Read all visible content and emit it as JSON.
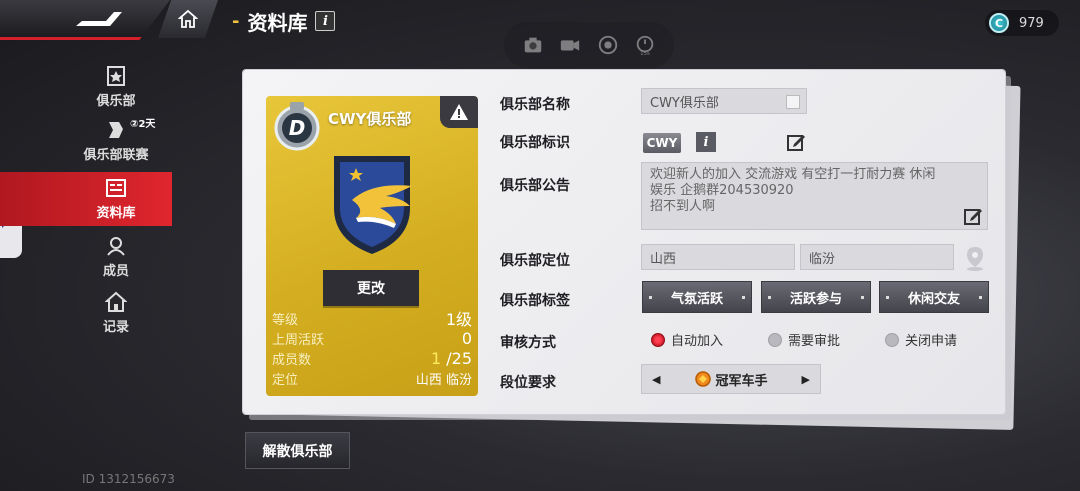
{
  "header": {
    "title": "资料库",
    "info_label": "i",
    "coins": "979",
    "coin_symbol": "C",
    "timer_label": "15s"
  },
  "sidebar": {
    "items": [
      {
        "label": "俱乐部",
        "icon": "club-icon"
      },
      {
        "label": "俱乐部联赛",
        "icon": "league-icon"
      },
      {
        "label": "资料库",
        "icon": "database-icon"
      },
      {
        "label": "成员",
        "icon": "members-icon"
      },
      {
        "label": "记录",
        "icon": "records-icon"
      }
    ],
    "league_timer": "②2天",
    "active_index": 2
  },
  "card": {
    "club_name": "CWY俱乐部",
    "rank_letter": "D",
    "change_label": "更改",
    "stats": {
      "level_label": "等级",
      "level_value": "1级",
      "activity_label": "上周活跃",
      "activity_value": "0",
      "members_label": "成员数",
      "members_current": "1",
      "members_max": "/25",
      "location_label": "定位",
      "location_value": "山西 临汾"
    }
  },
  "form": {
    "name_label": "俱乐部名称",
    "name_value": "CWY俱乐部",
    "tag_label": "俱乐部标识",
    "tag_value": "CWY",
    "tag_info": "i",
    "notice_label": "俱乐部公告",
    "notice_lines": [
      "欢迎新人的加入  交流游戏  有空打一打耐力赛 休闲",
      "娱乐 企鹅群204530920",
      "招不到人啊"
    ],
    "location_label": "俱乐部定位",
    "province": "山西",
    "city": "临汾",
    "tags_label": "俱乐部标签",
    "tags": [
      "气氛活跃",
      "活跃参与",
      "休闲交友"
    ],
    "review_label": "审核方式",
    "review_options": [
      "自动加入",
      "需要审批",
      "关闭申请"
    ],
    "review_selected": 0,
    "rank_label": "段位要求",
    "rank_value": "冠军车手",
    "rank_prev": "◀",
    "rank_next": "▶"
  },
  "footer": {
    "dissolve_label": "解散俱乐部",
    "user_id": "ID 1312156673"
  },
  "colors": {
    "accent_red": "#e0262e",
    "card_gold": "#d4ae20",
    "emblem_blue": "#25408a"
  }
}
